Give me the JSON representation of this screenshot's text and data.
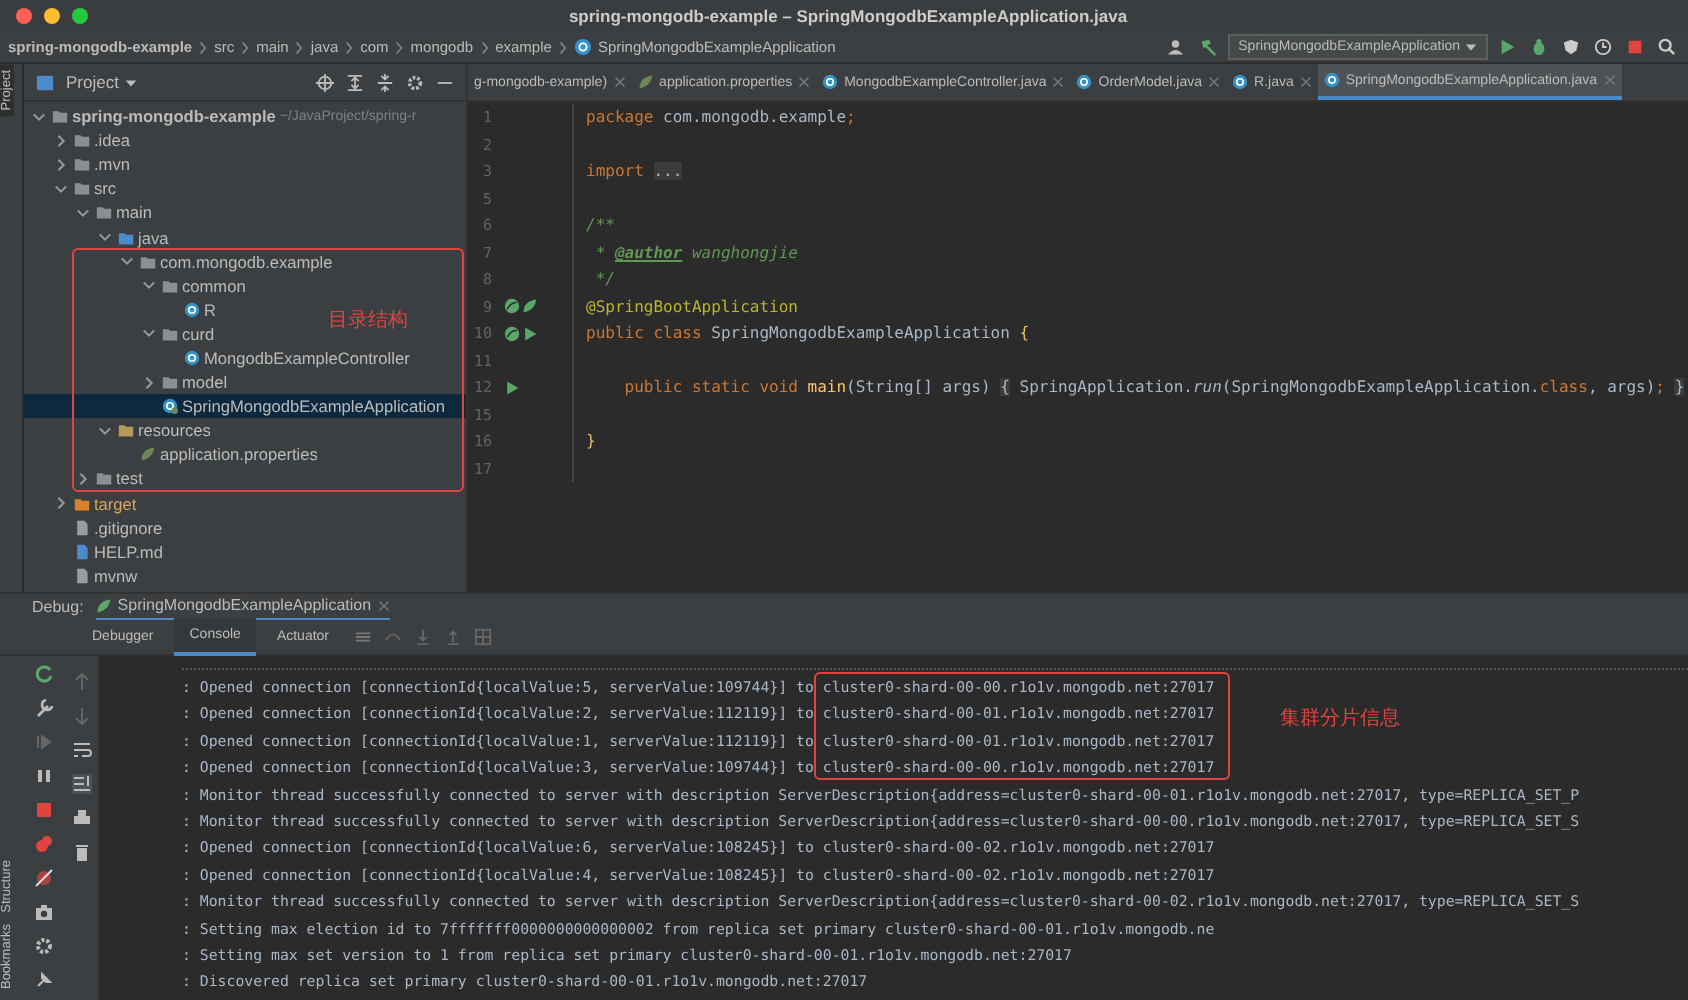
{
  "window": {
    "title": "spring-mongodb-example – SpringMongodbExampleApplication.java"
  },
  "breadcrumbs": [
    "spring-mongodb-example",
    "src",
    "main",
    "java",
    "com",
    "mongodb",
    "example",
    "SpringMongodbExampleApplication"
  ],
  "run_config": "SpringMongodbExampleApplication",
  "side_tabs": {
    "top": "Project",
    "bottom": [
      "Structure",
      "Bookmarks"
    ]
  },
  "project": {
    "title": "Project",
    "tree": [
      {
        "label": "spring-mongodb-example",
        "path": "~/JavaProject/spring-r",
        "kind": "module",
        "expanded": true,
        "selected": false,
        "children": [
          {
            "label": ".idea",
            "kind": "folder",
            "expanded": false,
            "selected": false
          },
          {
            "label": ".mvn",
            "kind": "folder",
            "expanded": false,
            "selected": false
          },
          {
            "label": "src",
            "kind": "folder",
            "expanded": true,
            "selected": false,
            "children": [
              {
                "label": "main",
                "kind": "folder",
                "expanded": true,
                "selected": false,
                "children": [
                  {
                    "label": "java",
                    "kind": "source",
                    "expanded": true,
                    "selected": false,
                    "children": [
                      {
                        "label": "com.mongodb.example",
                        "kind": "package",
                        "expanded": true,
                        "selected": false,
                        "children": [
                          {
                            "label": "common",
                            "kind": "package",
                            "expanded": true,
                            "selected": false,
                            "children": [
                              {
                                "label": "R",
                                "kind": "class",
                                "selected": false
                              }
                            ]
                          },
                          {
                            "label": "curd",
                            "kind": "package",
                            "expanded": true,
                            "selected": false,
                            "children": [
                              {
                                "label": "MongodbExampleController",
                                "kind": "class",
                                "selected": false
                              }
                            ]
                          },
                          {
                            "label": "model",
                            "kind": "package",
                            "expanded": false,
                            "selected": false
                          },
                          {
                            "label": "SpringMongodbExampleApplication",
                            "kind": "spring-class",
                            "selected": true
                          }
                        ]
                      }
                    ]
                  },
                  {
                    "label": "resources",
                    "kind": "resources",
                    "expanded": true,
                    "selected": false,
                    "children": [
                      {
                        "label": "application.properties",
                        "kind": "properties",
                        "selected": false
                      }
                    ]
                  }
                ]
              },
              {
                "label": "test",
                "kind": "folder",
                "expanded": false,
                "selected": false
              }
            ]
          },
          {
            "label": "target",
            "kind": "excluded",
            "expanded": false,
            "selected": false
          },
          {
            "label": ".gitignore",
            "kind": "file",
            "selected": false
          },
          {
            "label": "HELP.md",
            "kind": "markdown",
            "selected": false
          },
          {
            "label": "mvnw",
            "kind": "file",
            "selected": false
          }
        ]
      }
    ],
    "annotation": "目录结构"
  },
  "editor_tabs": [
    {
      "label": "g-mongodb-example)",
      "kind": "module",
      "selected": false
    },
    {
      "label": "application.properties",
      "kind": "properties",
      "selected": false
    },
    {
      "label": "MongodbExampleController.java",
      "kind": "class",
      "selected": false
    },
    {
      "label": "OrderModel.java",
      "kind": "class",
      "selected": false
    },
    {
      "label": "R.java",
      "kind": "class",
      "selected": false
    },
    {
      "label": "SpringMongodbExampleApplication.java",
      "kind": "spring-class",
      "selected": true
    }
  ],
  "code_lines": [
    {
      "number": "1",
      "tokens": [
        {
          "text": "package ",
          "kind": "keyword"
        },
        {
          "text": "com.mongodb.example",
          "kind": "plain"
        },
        {
          "text": ";",
          "kind": "keyword"
        }
      ]
    },
    {
      "number": "2"
    },
    {
      "number": "3",
      "tokens": [
        {
          "text": "import ",
          "kind": "keyword"
        },
        {
          "text": "...",
          "kind": "fold"
        }
      ]
    },
    {
      "number": "5"
    },
    {
      "number": "6",
      "tokens": [
        {
          "text": "/**",
          "kind": "doc"
        }
      ]
    },
    {
      "number": "7",
      "tokens": [
        {
          "text": " * ",
          "kind": "doc"
        },
        {
          "text": "@author",
          "kind": "doctag"
        },
        {
          "text": " wanghongjie",
          "kind": "doc"
        }
      ]
    },
    {
      "number": "8",
      "tokens": [
        {
          "text": " */",
          "kind": "doc"
        }
      ]
    },
    {
      "number": "9",
      "bean_icon": true,
      "leaf_icon": true,
      "run_icon": false,
      "tokens": [
        {
          "text": "@SpringBootApplication",
          "kind": "annotation"
        }
      ]
    },
    {
      "number": "10",
      "bean_icon": true,
      "leaf_icon": false,
      "run_icon": true,
      "tokens": [
        {
          "text": "public class ",
          "kind": "keyword"
        },
        {
          "text": "SpringMongodbExampleApplication ",
          "kind": "plain"
        },
        {
          "text": "{",
          "kind": "brace"
        }
      ]
    },
    {
      "number": "11"
    },
    {
      "number": "12",
      "bean_icon": false,
      "leaf_icon": false,
      "run_icon": true,
      "tokens": [
        {
          "text": "    public static void ",
          "kind": "keyword"
        },
        {
          "text": "main",
          "kind": "method"
        },
        {
          "text": "(String[] args) ",
          "kind": "plain"
        },
        {
          "text": "{",
          "kind": "fold"
        },
        {
          "text": " SpringApplication.",
          "kind": "plain"
        },
        {
          "text": "run",
          "kind": "static"
        },
        {
          "text": "(SpringMongodbExampleApplication.",
          "kind": "plain"
        },
        {
          "text": "class",
          "kind": "keyword"
        },
        {
          "text": ", args)",
          "kind": "plain"
        },
        {
          "text": "; ",
          "kind": "keyword"
        },
        {
          "text": "}",
          "kind": "fold"
        }
      ]
    },
    {
      "number": "15"
    },
    {
      "number": "16",
      "tokens": [
        {
          "text": "}",
          "kind": "brace"
        }
      ]
    },
    {
      "number": "17"
    }
  ],
  "debug": {
    "label": "Debug:",
    "session": "SpringMongodbExampleApplication",
    "tabs": [
      {
        "label": "Debugger",
        "selected": false
      },
      {
        "label": "Console",
        "selected": true
      },
      {
        "label": "Actuator",
        "selected": false
      }
    ],
    "console_lines": [
      ": Opened connection [connectionId{localValue:5, serverValue:109744}] to cluster0-shard-00-00.r1o1v.mongodb.net:27017",
      ": Opened connection [connectionId{localValue:2, serverValue:112119}] to cluster0-shard-00-01.r1o1v.mongodb.net:27017",
      ": Opened connection [connectionId{localValue:1, serverValue:112119}] to cluster0-shard-00-01.r1o1v.mongodb.net:27017",
      ": Opened connection [connectionId{localValue:3, serverValue:109744}] to cluster0-shard-00-00.r1o1v.mongodb.net:27017",
      ": Monitor thread successfully connected to server with description ServerDescription{address=cluster0-shard-00-01.r1o1v.mongodb.net:27017, type=REPLICA_SET_P",
      ": Monitor thread successfully connected to server with description ServerDescription{address=cluster0-shard-00-00.r1o1v.mongodb.net:27017, type=REPLICA_SET_S",
      ": Opened connection [connectionId{localValue:6, serverValue:108245}] to cluster0-shard-00-02.r1o1v.mongodb.net:27017",
      ": Opened connection [connectionId{localValue:4, serverValue:108245}] to cluster0-shard-00-02.r1o1v.mongodb.net:27017",
      ": Monitor thread successfully connected to server with description ServerDescription{address=cluster0-shard-00-02.r1o1v.mongodb.net:27017, type=REPLICA_SET_S",
      ": Setting max election id to 7fffffff0000000000000002 from replica set primary cluster0-shard-00-01.r1o1v.mongodb.ne",
      ": Setting max set version to 1 from replica set primary cluster0-shard-00-01.r1o1v.mongodb.net:27017",
      ": Discovered replica set primary cluster0-shard-00-01.r1o1v.mongodb.net:27017"
    ],
    "annotation": "集群分片信息"
  }
}
